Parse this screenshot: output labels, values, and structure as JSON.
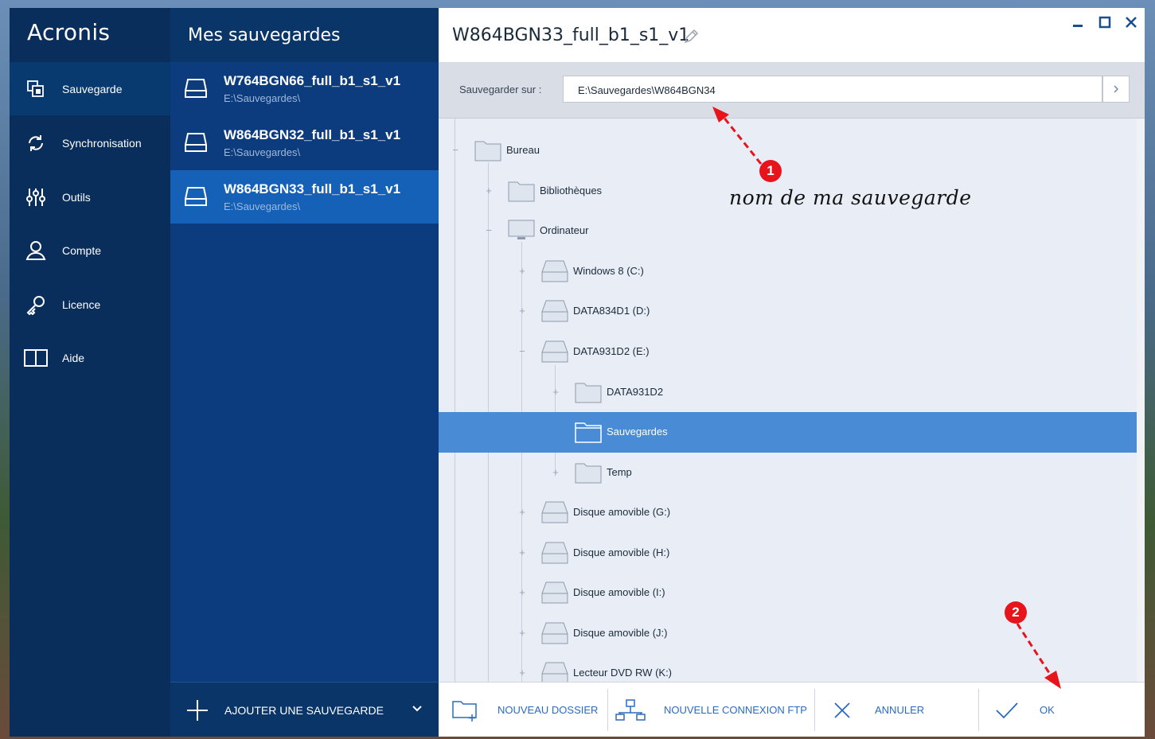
{
  "app": {
    "logo": "Acronis"
  },
  "nav": {
    "items": [
      {
        "label": "Sauvegarde",
        "icon": "backup-icon",
        "active": true
      },
      {
        "label": "Synchronisation",
        "icon": "sync-icon",
        "active": false
      },
      {
        "label": "Outils",
        "icon": "tools-icon",
        "active": false
      },
      {
        "label": "Compte",
        "icon": "account-icon",
        "active": false
      },
      {
        "label": "Licence",
        "icon": "key-icon",
        "active": false
      },
      {
        "label": "Aide",
        "icon": "book-icon",
        "active": false
      }
    ]
  },
  "backups": {
    "title": "Mes sauvegardes",
    "items": [
      {
        "name": "W764BGN66_full_b1_s1_v1",
        "path": "E:\\Sauvegardes\\",
        "selected": false
      },
      {
        "name": "W864BGN32_full_b1_s1_v1",
        "path": "E:\\Sauvegardes\\",
        "selected": false
      },
      {
        "name": "W864BGN33_full_b1_s1_v1",
        "path": "E:\\Sauvegardes\\",
        "selected": true
      }
    ],
    "add_label": "AJOUTER UNE SAUVEGARDE"
  },
  "detail": {
    "title": "W864BGN33_full_b1_s1_v1",
    "dest_label": "Sauvegarder sur :",
    "dest_value": "E:\\Sauvegardes\\W864BGN34"
  },
  "tree": [
    {
      "label": "Bureau",
      "icon": "folder-icon",
      "expander": "−"
    },
    {
      "label": "Bibliothèques",
      "icon": "folder-icon",
      "expander": "+"
    },
    {
      "label": "Ordinateur",
      "icon": "computer-icon",
      "expander": "−"
    },
    {
      "label": "Windows 8 (C:)",
      "icon": "drive-icon",
      "expander": "+"
    },
    {
      "label": "DATA834D1 (D:)",
      "icon": "drive-icon",
      "expander": "+"
    },
    {
      "label": "DATA931D2 (E:)",
      "icon": "drive-icon",
      "expander": "−"
    },
    {
      "label": "DATA931D2",
      "icon": "folder-icon",
      "expander": "+"
    },
    {
      "label": "Sauvegardes",
      "icon": "folder-icon",
      "expander": "",
      "selected": true
    },
    {
      "label": "Temp",
      "icon": "folder-icon",
      "expander": "+"
    },
    {
      "label": "Disque amovible (G:)",
      "icon": "drive-icon",
      "expander": "+"
    },
    {
      "label": "Disque amovible (H:)",
      "icon": "drive-icon",
      "expander": "+"
    },
    {
      "label": "Disque amovible (I:)",
      "icon": "drive-icon",
      "expander": "+"
    },
    {
      "label": "Disque amovible (J:)",
      "icon": "drive-icon",
      "expander": "+"
    },
    {
      "label": "Lecteur DVD RW (K:)",
      "icon": "dvd-drive-icon",
      "expander": "+"
    }
  ],
  "footer": {
    "new_folder": "NOUVEAU DOSSIER",
    "new_ftp": "NOUVELLE CONNEXION FTP",
    "cancel": "ANNULER",
    "ok": "OK"
  },
  "annotations": {
    "marker1": "1",
    "marker2": "2",
    "note": "nom de ma sauvegarde",
    "color": "#e8141c"
  },
  "colors": {
    "nav_bg": "#0a2e5c",
    "list_bg": "#0d3c7e",
    "selected_item": "#1561b8",
    "tree_selected": "#4a8bd6",
    "accent_text": "#2a6bc0"
  }
}
